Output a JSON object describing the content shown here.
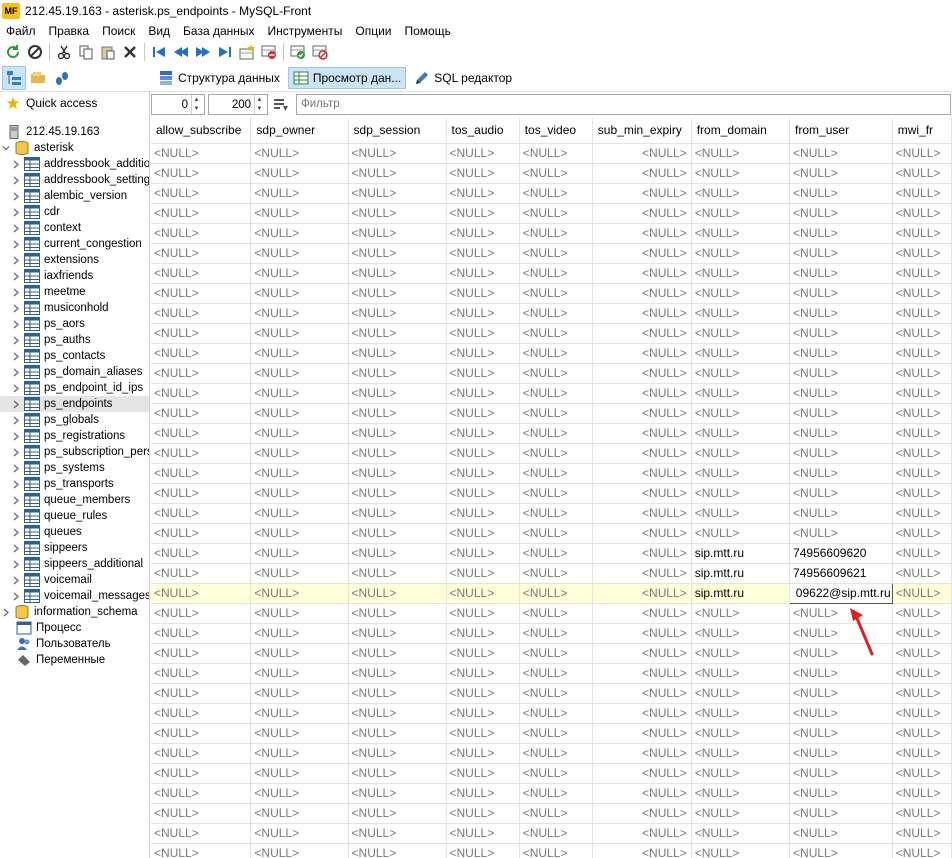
{
  "window": {
    "app_logo": "MF",
    "title": "212.45.19.163 - asterisk.ps_endpoints - MySQL-Front"
  },
  "menu": [
    "Файл",
    "Правка",
    "Поиск",
    "Вид",
    "База данных",
    "Инструменты",
    "Опции",
    "Помощь"
  ],
  "view_tabs": {
    "structure": "Структура данных",
    "browse": "Просмотр дан...",
    "sql": "SQL редактор"
  },
  "sidebar": {
    "quick_access": "Quick access",
    "host": "212.45.19.163",
    "database": "asterisk",
    "tables": [
      "addressbook_additional",
      "addressbook_settings",
      "alembic_version",
      "cdr",
      "context",
      "current_congestion",
      "extensions",
      "iaxfriends",
      "meetme",
      "musiconhold",
      "ps_aors",
      "ps_auths",
      "ps_contacts",
      "ps_domain_aliases",
      "ps_endpoint_id_ips",
      "ps_endpoints",
      "ps_globals",
      "ps_registrations",
      "ps_subscription_persistence",
      "ps_systems",
      "ps_transports",
      "queue_members",
      "queue_rules",
      "queues",
      "sippeers",
      "sippeers_additional",
      "voicemail",
      "voicemail_messages"
    ],
    "selected_table": "ps_endpoints",
    "other_db": "information_schema",
    "process": "Процесс",
    "users": "Пользователь",
    "variables": "Переменные"
  },
  "filter": {
    "offset": "0",
    "limit": "200",
    "placeholder": "Фильтр"
  },
  "grid": {
    "columns": [
      "allow_subscribe",
      "sdp_owner",
      "sdp_session",
      "tos_audio",
      "tos_video",
      "sub_min_expiry",
      "from_domain",
      "from_user",
      "mwi_fr"
    ],
    "null_text": "<NULL>",
    "special_rows": [
      {
        "row": 20,
        "from_domain": "sip.mtt.ru",
        "from_user": "74956609620"
      },
      {
        "row": 21,
        "from_domain": "sip.mtt.ru",
        "from_user": "74956609621"
      },
      {
        "row": 22,
        "from_domain": "sip.mtt.ru",
        "from_user": "09622@sip.mtt.ru",
        "highlighted": true,
        "editing": true
      }
    ],
    "visible_rows": 36
  },
  "colors": {
    "highlight_row": "#ffffd8",
    "selection": "#cce4f7",
    "arrow": "#e02020"
  }
}
